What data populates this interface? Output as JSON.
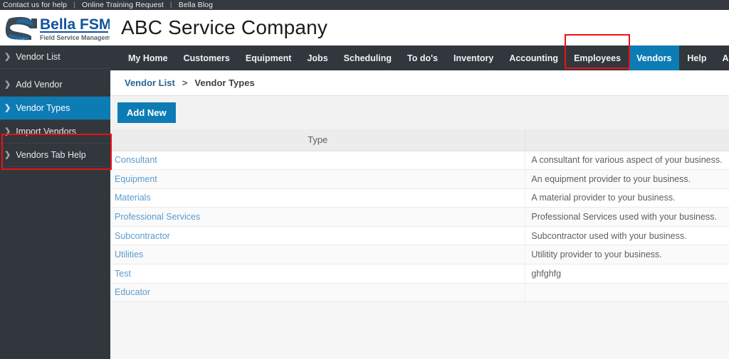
{
  "topbar": {
    "links": [
      {
        "label": "Contact us for help"
      },
      {
        "label": "Online Training Request"
      },
      {
        "label": "Bella Blog"
      }
    ],
    "separator": "|"
  },
  "brand": {
    "name": "Bella FSM",
    "tagline": "Field Service Management",
    "logo_icon": "bella-swoosh-logo"
  },
  "header": {
    "company_title": "ABC Service Company"
  },
  "sidebar": {
    "items": [
      {
        "label": "Vendor List",
        "icon": "chevron-right-icon",
        "active": false
      },
      {
        "label": "Add Vendor",
        "icon": "chevron-right-icon",
        "active": false
      },
      {
        "label": "Vendor Types",
        "icon": "chevron-right-icon",
        "active": true
      },
      {
        "label": "Import Vendors",
        "icon": "chevron-right-icon",
        "active": false
      },
      {
        "label": "Vendors Tab Help",
        "icon": "chevron-right-icon",
        "active": false
      }
    ]
  },
  "navbar": {
    "items": [
      {
        "label": "My Home",
        "active": false
      },
      {
        "label": "Customers",
        "active": false
      },
      {
        "label": "Equipment",
        "active": false
      },
      {
        "label": "Jobs",
        "active": false
      },
      {
        "label": "Scheduling",
        "active": false
      },
      {
        "label": "To do's",
        "active": false
      },
      {
        "label": "Inventory",
        "active": false
      },
      {
        "label": "Accounting",
        "active": false
      },
      {
        "label": "Employees",
        "active": false
      },
      {
        "label": "Vendors",
        "active": true
      },
      {
        "label": "Help",
        "active": false
      },
      {
        "label": "Admin",
        "active": false
      }
    ]
  },
  "breadcrumb": {
    "parent": "Vendor List",
    "separator": ">",
    "current": "Vendor Types"
  },
  "toolbar": {
    "add_new_label": "Add New"
  },
  "table": {
    "headers": {
      "type": "Type",
      "description": ""
    },
    "rows": [
      {
        "type": "Consultant",
        "description": "A consultant for various aspect of your business."
      },
      {
        "type": "Equipment",
        "description": "An equipment provider to your business."
      },
      {
        "type": "Materials",
        "description": "A material provider to your business."
      },
      {
        "type": "Professional Services",
        "description": "Professional Services used with your business."
      },
      {
        "type": "Subcontractor",
        "description": "Subcontractor used with your business."
      },
      {
        "type": "Utilities",
        "description": "Utilitity provider to your business."
      },
      {
        "type": "Test",
        "description": "ghfghfg"
      },
      {
        "type": "Educator",
        "description": ""
      }
    ]
  },
  "annotations": [
    {
      "name": "vendors-tab-highlight",
      "color": "#ee1111"
    },
    {
      "name": "vendor-types-highlight",
      "color": "#ee1111"
    }
  ],
  "colors": {
    "accent_blue": "#0d7cb5",
    "dark_chrome": "#31373d",
    "link_blue": "#5b9bd0",
    "annotation_red": "#ee1111"
  }
}
